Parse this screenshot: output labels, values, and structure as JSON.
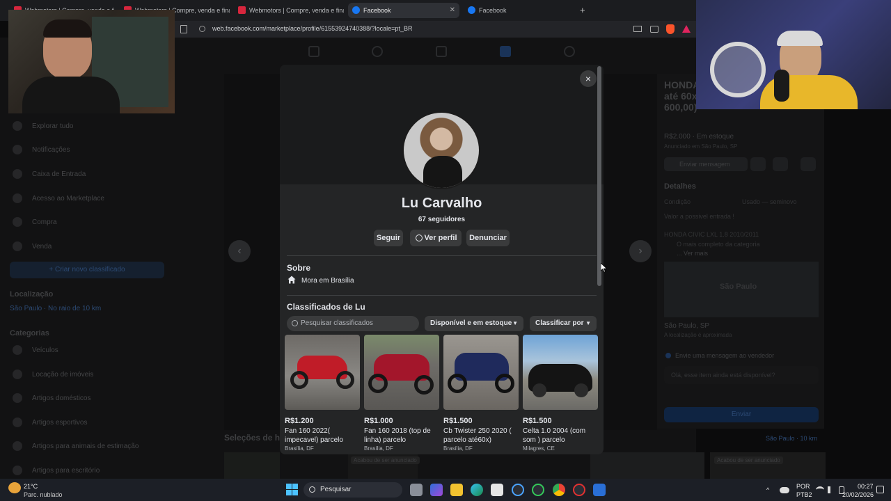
{
  "browser": {
    "tabs": [
      {
        "label": "Webmotors | Compre, venda e finan",
        "active": false
      },
      {
        "label": "Webmotors | Compre, venda e financ",
        "active": false
      },
      {
        "label": "Webmotors | Compre, venda e financ",
        "active": false
      },
      {
        "label": "Facebook",
        "active": true
      },
      {
        "label": "Facebook",
        "active": false
      }
    ],
    "new_tab": "+",
    "url": "web.facebook.com/marketplace/profile/61553924740388/?locale=pt_BR"
  },
  "sidebar": {
    "items": [
      "Explorar tudo",
      "Notificações",
      "Caixa de Entrada",
      "Acesso ao Marketplace",
      "Compra",
      "Venda"
    ],
    "create_listing": "+ Criar novo classificado",
    "location_title": "Localização",
    "location_value": "São Paulo · No raio de 10 km",
    "categories_title": "Categorias",
    "categories": [
      "Veículos",
      "Locação de imóveis",
      "Artigos domésticos",
      "Artigos esportivos",
      "Artigos para animais de estimação",
      "Artigos para escritório"
    ]
  },
  "listing": {
    "title": "HONDA CIVIC 2010/2011 parcelo até 60x(PARCELAS A APARTIR DE 600,00)",
    "price": "R$2.000 · Em estoque",
    "posted": "Anunciado em São Paulo, SP",
    "send_message": "Enviar mensagem",
    "details_title": "Detalhes",
    "condition_label": "Condição",
    "condition_value": "Usado — seminovo",
    "desc1": "Valor a possivel entrada !",
    "desc2": "HONDA CIVIC LXL 1.8 2010/2011",
    "desc3": "O mais completo da categoria",
    "see_more": "... Ver mais",
    "map_city": "São Paulo",
    "location": "São Paulo, SP",
    "location_note": "A localização é aproximada",
    "message_header": "Envie uma mensagem ao vendedor",
    "message_text": "Olá, esse item ainda está disponível?",
    "send": "Enviar"
  },
  "below": {
    "section_title": "Seleções de h",
    "location_chip": "São Paulo · 10 km",
    "badge1": "Acabou de ser anunciado",
    "badge2": "Acabou de ser anunciado"
  },
  "modal": {
    "close": "×",
    "name": "Lu Carvalho",
    "followers": "67 seguidores",
    "buttons": {
      "follow": "Seguir",
      "view_profile": "Ver perfil",
      "report": "Denunciar"
    },
    "about_title": "Sobre",
    "about_text": "Mora em Brasília",
    "listings_title": "Classificados de Lu",
    "search_placeholder": "Pesquisar classificados",
    "filter_availability": "Disponível e em estoque",
    "sort": "Classificar por",
    "items": [
      {
        "price": "R$1.200",
        "title": "Fan 160 2022( impecavel) parcelo",
        "location": "Brasília, DF"
      },
      {
        "price": "R$1.000",
        "title": "Fan 160 2018 (top de linha) parcelo",
        "location": "Brasília, DF"
      },
      {
        "price": "R$1.500",
        "title": "Cb Twister 250 2020 ( parcelo até60x)",
        "location": "Brasília, DF"
      },
      {
        "price": "R$1.500",
        "title": "Celta 1.0 2004 (com som ) parcelo",
        "location": "Milagres, CE"
      }
    ]
  },
  "taskbar": {
    "weather_temp": "21°C",
    "weather_desc": "Parc. nublado",
    "search": "Pesquisar",
    "lang": "POR",
    "layout": "PTB2",
    "time": "00:27",
    "date": "20/02/2026"
  }
}
